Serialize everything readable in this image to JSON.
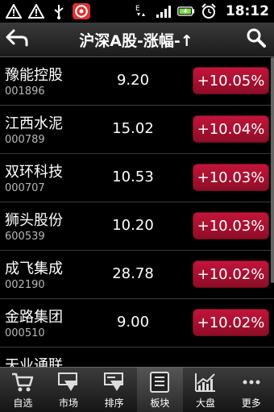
{
  "status": {
    "time": "18:12",
    "icons": [
      "warning-icon",
      "warning-icon",
      "usb-icon",
      "app-logo-icon",
      "data-e-icon",
      "signal-icon",
      "battery-icon",
      "alarm-icon"
    ]
  },
  "header": {
    "title": "沪深A股-涨幅-↑",
    "back_icon": "back-arrow-icon",
    "search_icon": "search-icon"
  },
  "stocks": [
    {
      "name": "豫能控股",
      "code": "001896",
      "price": "9.20",
      "change": "+10.05%"
    },
    {
      "name": "江西水泥",
      "code": "000789",
      "price": "15.02",
      "change": "+10.04%"
    },
    {
      "name": "双环科技",
      "code": "000707",
      "price": "10.53",
      "change": "+10.03%"
    },
    {
      "name": "狮头股份",
      "code": "600539",
      "price": "10.20",
      "change": "+10.03%"
    },
    {
      "name": "成飞集成",
      "code": "002190",
      "price": "28.78",
      "change": "+10.02%"
    },
    {
      "name": "金路集团",
      "code": "000510",
      "price": "9.00",
      "change": "+10.02%"
    },
    {
      "name": "天业通联",
      "code": "",
      "price": "",
      "change": ""
    }
  ],
  "colors": {
    "change_up": "#b01232",
    "background": "#000000"
  },
  "tabs": [
    {
      "label": "自选",
      "icon": "cart-icon"
    },
    {
      "label": "市场",
      "icon": "market-down-arrow-icon"
    },
    {
      "label": "排序",
      "icon": "sort-icon"
    },
    {
      "label": "板块",
      "icon": "sector-icon",
      "active": true
    },
    {
      "label": "大盘",
      "icon": "index-chart-icon"
    },
    {
      "label": "更多",
      "icon": "more-icon"
    }
  ]
}
